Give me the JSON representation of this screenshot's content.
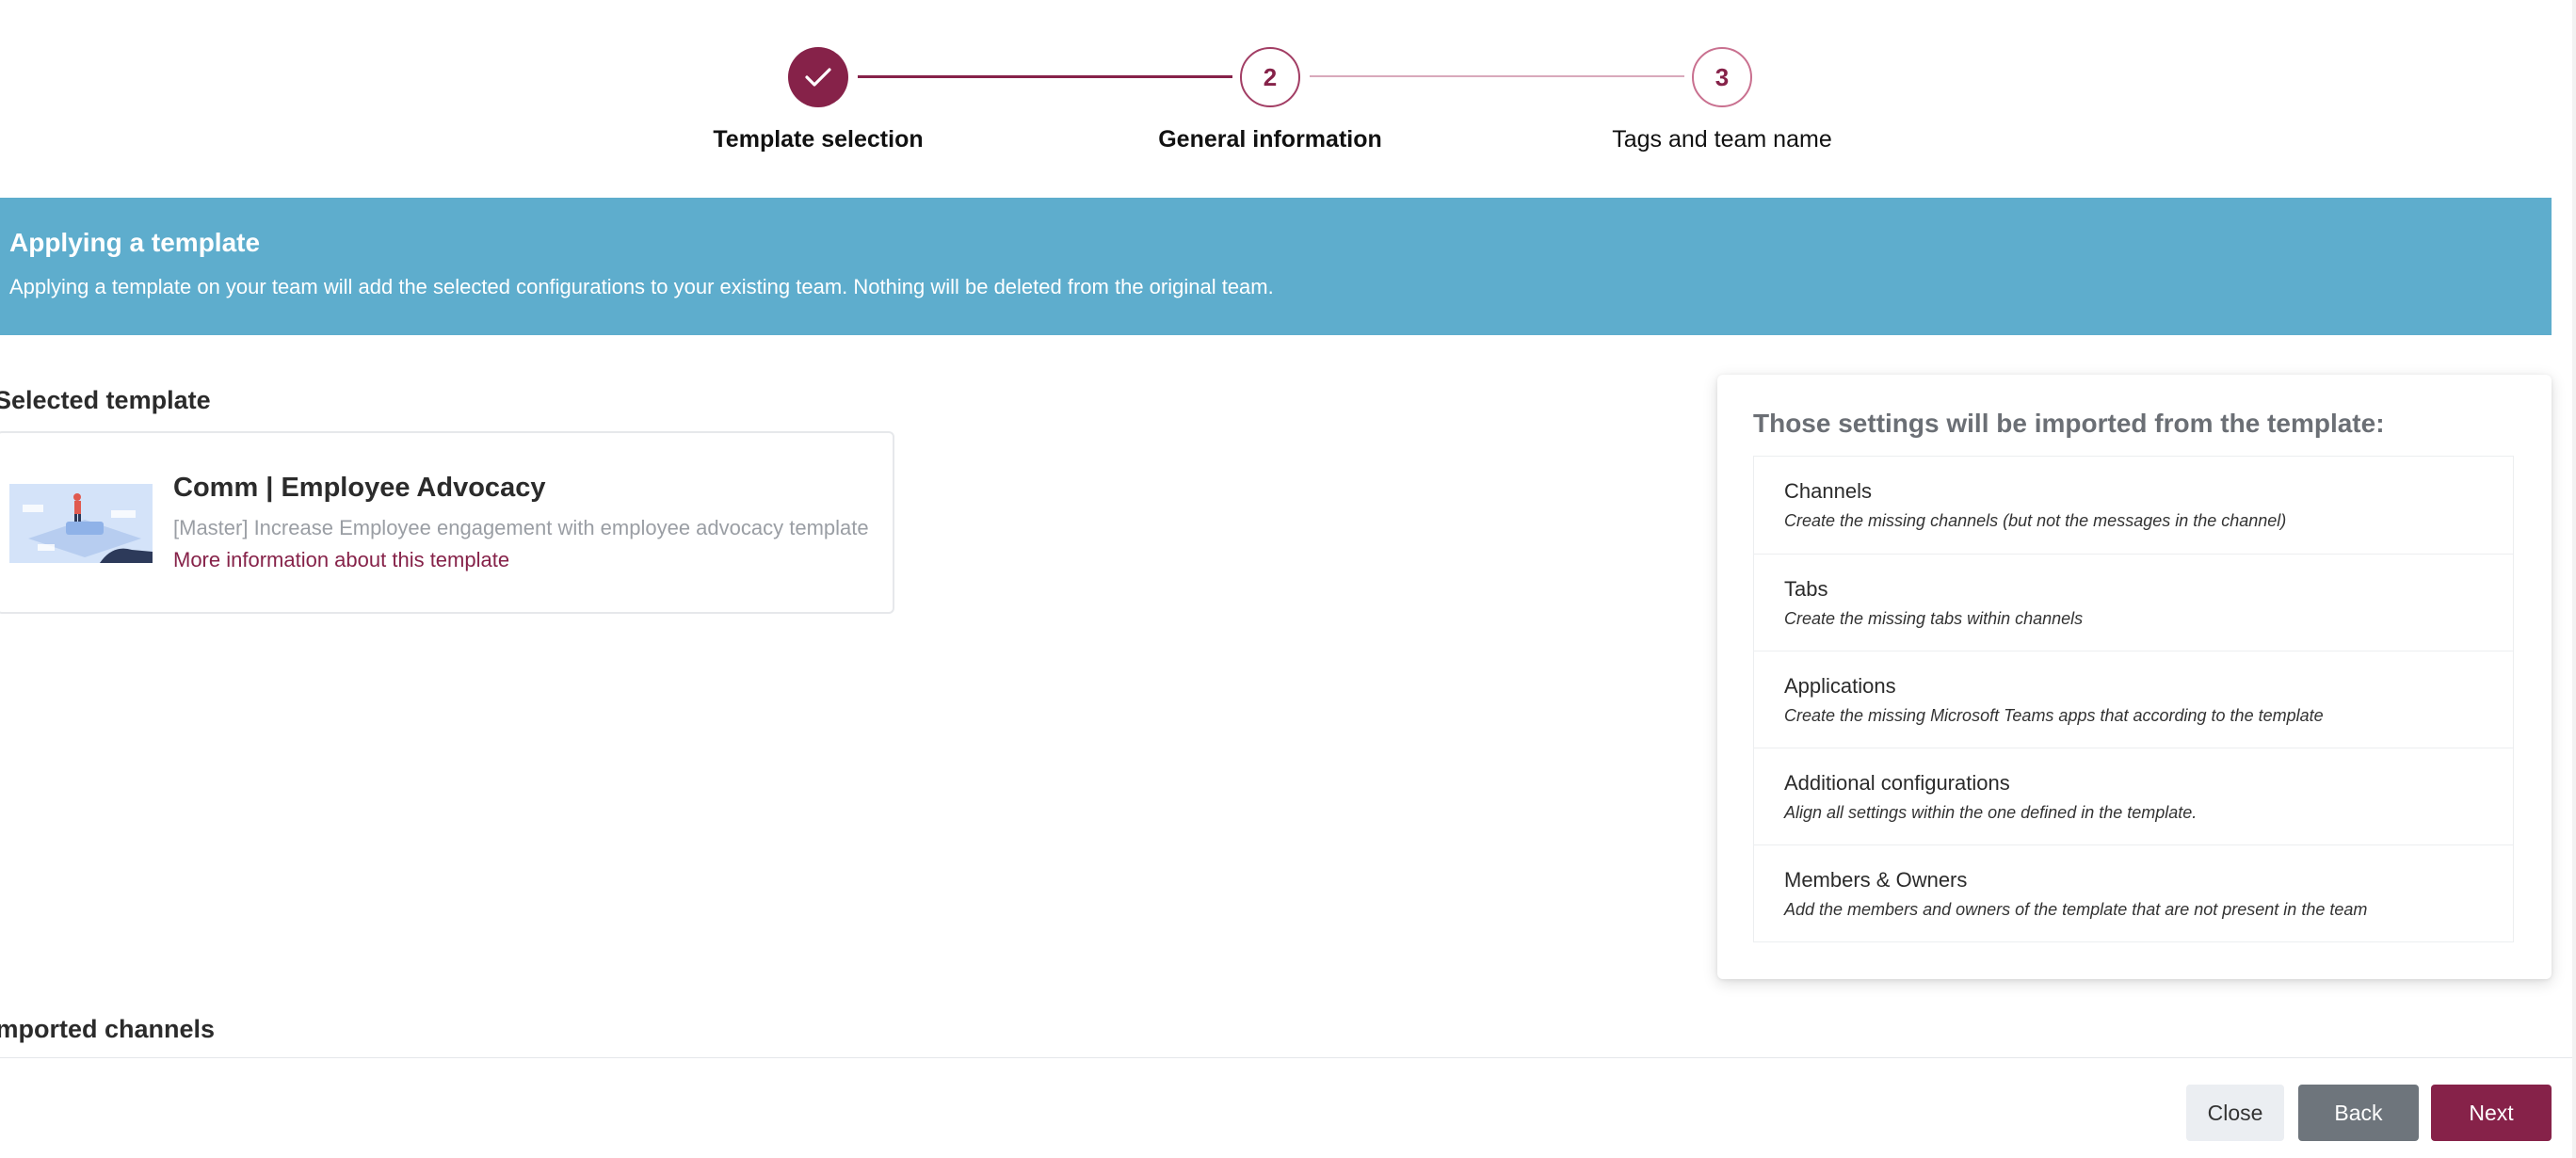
{
  "stepper": {
    "steps": [
      {
        "number": "",
        "label": "Template selection",
        "status": "done"
      },
      {
        "number": "2",
        "label": "General information",
        "status": "active"
      },
      {
        "number": "3",
        "label": "Tags and team name",
        "status": "todo"
      }
    ]
  },
  "banner": {
    "title": "Applying a template",
    "text": "Applying a template on your team will add the selected configurations to your existing team. Nothing will be deleted from the original team."
  },
  "selected_template": {
    "heading": "Selected template",
    "name": "Comm | Employee Advocacy",
    "description": "[Master] Increase Employee engagement with employee advocacy template",
    "link": "More information about this template"
  },
  "settings": {
    "title": "Those settings will be imported from the template:",
    "items": [
      {
        "title": "Channels",
        "desc": "Create the missing channels (but not the messages in the channel)"
      },
      {
        "title": "Tabs",
        "desc": "Create the missing tabs within channels"
      },
      {
        "title": "Applications",
        "desc": "Create the missing Microsoft Teams apps that according to the template"
      },
      {
        "title": "Additional configurations",
        "desc": "Align all settings within the one defined in the template."
      },
      {
        "title": "Members & Owners",
        "desc": "Add the members and owners of the template that are not present in the team"
      }
    ]
  },
  "imported_channels": {
    "heading": "Imported channels"
  },
  "footer": {
    "close": "Close",
    "back": "Back",
    "next": "Next"
  },
  "colors": {
    "accent": "#862249",
    "banner": "#5eadcd",
    "back_button": "#6e757c"
  },
  "icons": {
    "completed_step": "check-icon"
  }
}
